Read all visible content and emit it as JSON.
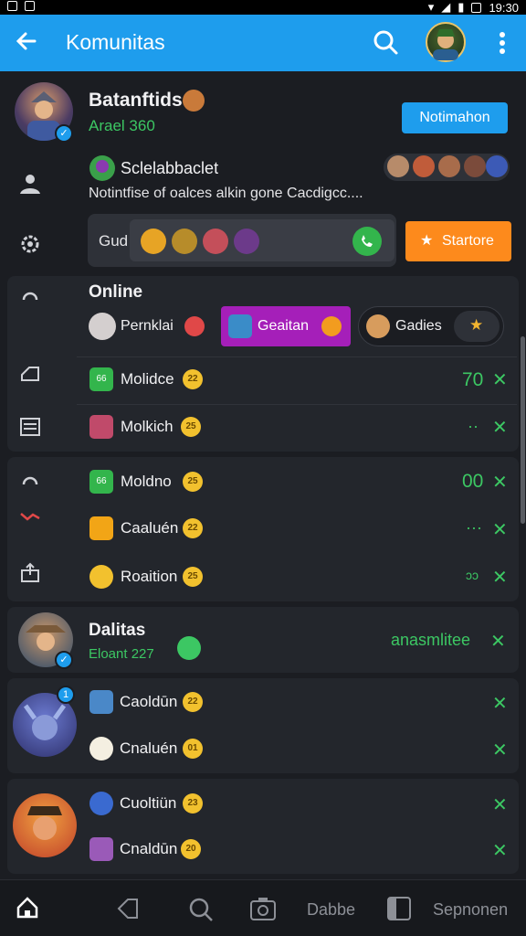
{
  "status_bar": {
    "time": "19:30"
  },
  "app_bar": {
    "title": "Komunitas"
  },
  "profile": {
    "name": "Batanftids",
    "subtitle": "Arael 360",
    "notify_button": "Notimahon"
  },
  "friend_row": {
    "name": "Sclelabbaclet",
    "message": "Notintfise of oalces alkin gone Cacdigcc...."
  },
  "game_row": {
    "label": "Gud",
    "start_button": "Startore"
  },
  "online_section": {
    "heading": "Online",
    "chips": [
      "Pernklai",
      "Geaitan",
      "Gadies"
    ],
    "items": [
      {
        "label": "Molidce",
        "coin": "22",
        "status": "70"
      },
      {
        "label": "Molkich",
        "coin": "25",
        "status": "··"
      }
    ]
  },
  "second_section": {
    "items": [
      {
        "label": "Moldno",
        "coin": "25",
        "status": "00"
      },
      {
        "label": "Caaluén",
        "coin": "22",
        "status": "···"
      },
      {
        "label": "Roaition",
        "coin": "25",
        "status": "ɔɔ"
      }
    ]
  },
  "dalitas": {
    "name": "Dalitas",
    "subtitle": "Eloant 227",
    "action": "anasmlitee"
  },
  "group_a": {
    "items": [
      {
        "label": "Caoldūn",
        "coin": "22"
      },
      {
        "label": "Cnaluén",
        "coin": "01"
      }
    ]
  },
  "group_b": {
    "items": [
      {
        "label": "Cuoltiün",
        "coin": "23"
      },
      {
        "label": "Cnaldūn",
        "coin": "20"
      }
    ]
  },
  "bottom_nav": {
    "tab4": "Dabbe",
    "tab6": "Sepnonen"
  },
  "colors": {
    "appbar": "#1e9ded",
    "accent_green": "#3cc763",
    "start_orange": "#fd8a1c",
    "chip_purple": "#a51fb9"
  }
}
